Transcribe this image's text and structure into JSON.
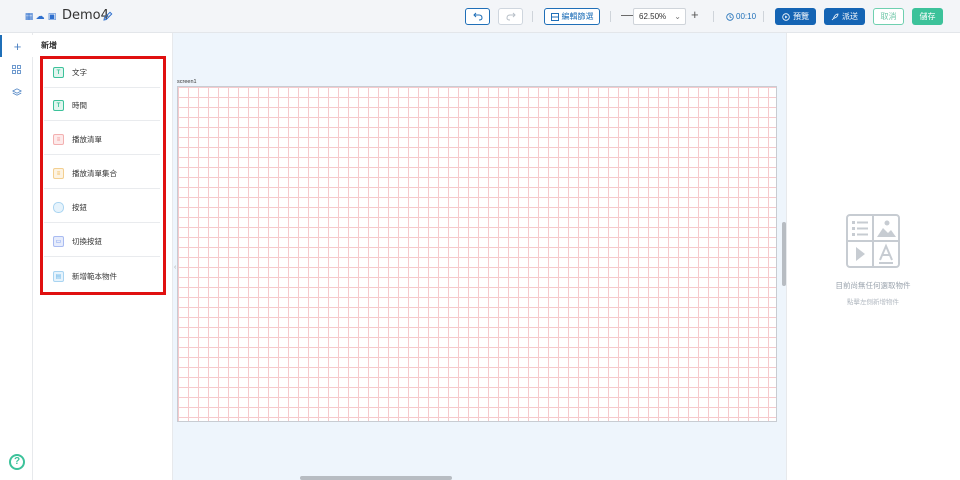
{
  "header": {
    "project_title": "Demo4",
    "preview_grid_label": "編輯篩選",
    "zoom_value": "62.50%",
    "zoom_minus": "—",
    "zoom_plus": "+",
    "timer": "00:10",
    "preview_label": "預覽",
    "send_label": "派送",
    "cancel_label": "取消",
    "save_label": "儲存"
  },
  "panel": {
    "title": "新增",
    "items": [
      {
        "label": "文字",
        "icon": "text-icon",
        "color": "#3cc29a"
      },
      {
        "label": "時間",
        "icon": "clock-icon",
        "color": "#3cc29a"
      },
      {
        "label": "播放清單",
        "icon": "playlist-icon",
        "color": "#f08a8a"
      },
      {
        "label": "播放清單集合",
        "icon": "playlist-set-icon",
        "color": "#f0b24a"
      },
      {
        "label": "按鈕",
        "icon": "button-icon",
        "color": "#6cb6e8"
      },
      {
        "label": "切換按鈕",
        "icon": "toggle-button-icon",
        "color": "#6c8ee8"
      },
      {
        "label": "新增範本物件",
        "icon": "template-icon",
        "color": "#6cb6e8"
      }
    ]
  },
  "canvas": {
    "screen_name": "screen1"
  },
  "properties": {
    "empty_title": "目前尚無任何選取物件",
    "empty_hint": "點擊左側新增物件"
  },
  "colors": {
    "primary": "#1464b4",
    "success": "#3cc29a",
    "highlight": "#e01010",
    "grid": "#f6c9cc"
  }
}
